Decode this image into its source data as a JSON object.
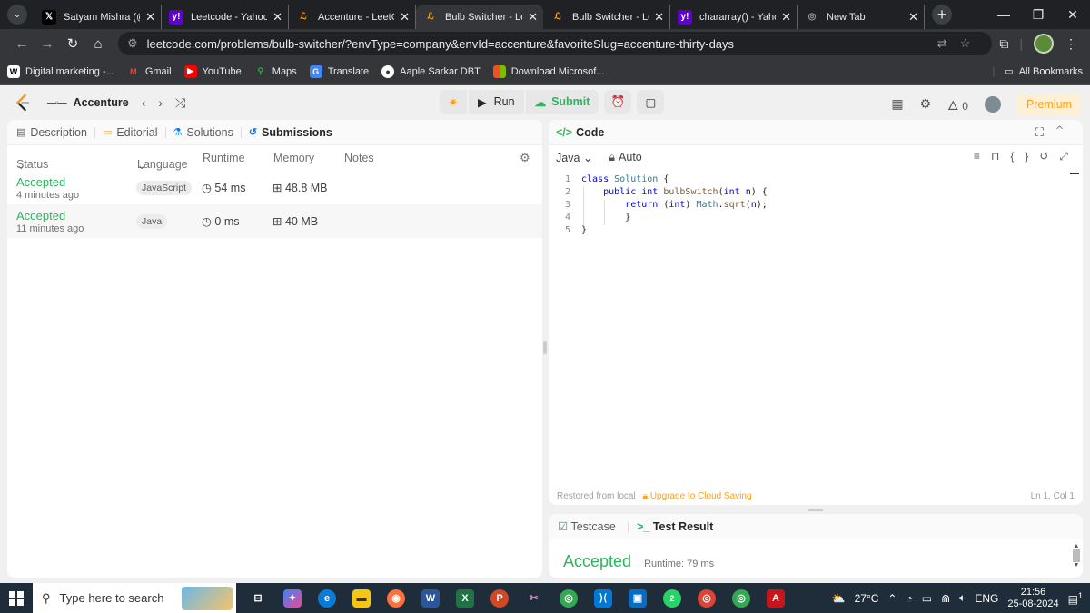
{
  "browser": {
    "tabs": [
      {
        "title": "Satyam Mishra (@its",
        "favicon": "x-icon",
        "active": false
      },
      {
        "title": "Leetcode - Yahoo Ind",
        "favicon": "yahoo-icon",
        "active": false
      },
      {
        "title": "Accenture - LeetCode",
        "favicon": "leetcode-icon",
        "active": false
      },
      {
        "title": "Bulb Switcher - LeetC",
        "favicon": "leetcode-icon",
        "active": true
      },
      {
        "title": "Bulb Switcher - LeetC",
        "favicon": "leetcode-icon",
        "active": false
      },
      {
        "title": "chararray() - Yahoo In",
        "favicon": "yahoo-icon",
        "active": false
      },
      {
        "title": "New Tab",
        "favicon": "globe-icon",
        "active": false
      }
    ],
    "url": "leetcode.com/problems/bulb-switcher/?envType=company&envId=accenture&favoriteSlug=accenture-thirty-days",
    "bookmarks": [
      {
        "label": "Digital marketing -...",
        "icon": "w-icon"
      },
      {
        "label": "Gmail",
        "icon": "gmail-icon"
      },
      {
        "label": "YouTube",
        "icon": "youtube-icon"
      },
      {
        "label": "Maps",
        "icon": "maps-icon"
      },
      {
        "label": "Translate",
        "icon": "translate-icon"
      },
      {
        "label": "Aaple Sarkar DBT",
        "icon": "circle-icon"
      },
      {
        "label": "Download Microsof...",
        "icon": "microsoft-icon"
      }
    ],
    "all_bookmarks": "All Bookmarks"
  },
  "lc_nav": {
    "problem_list": "Accenture",
    "run_label": "Run",
    "submit_label": "Submit",
    "streak_count": "0",
    "premium_label": "Premium"
  },
  "left_panel": {
    "tabs": [
      "Description",
      "Editorial",
      "Solutions",
      "Submissions"
    ],
    "columns": [
      "Status",
      "Language",
      "Runtime",
      "Memory",
      "Notes"
    ],
    "submissions": [
      {
        "status": "Accepted",
        "time": "4 minutes ago",
        "language": "JavaScript",
        "runtime": "54 ms",
        "memory": "48.8 MB"
      },
      {
        "status": "Accepted",
        "time": "11 minutes ago",
        "language": "Java",
        "runtime": "0 ms",
        "memory": "40 MB"
      }
    ]
  },
  "code_panel": {
    "title": "Code",
    "language": "Java",
    "mode": "Auto",
    "lines": [
      "1",
      "2",
      "3",
      "4",
      "5"
    ],
    "footer_saved": "Restored from local",
    "footer_upgrade": "Upgrade to Cloud Saving",
    "cursor_pos": "Ln 1, Col 1"
  },
  "result_panel": {
    "tab_testcase": "Testcase",
    "tab_result": "Test Result",
    "status": "Accepted",
    "runtime": "Runtime: 79 ms"
  },
  "taskbar": {
    "search_placeholder": "Type here to search",
    "temperature": "27°C",
    "lang": "ENG",
    "time": "21:56",
    "date": "25-08-2024",
    "notification_count": "1",
    "whatsapp_badge": "2"
  },
  "colors": {
    "accent_green": "#2db55d",
    "premium_orange": "#ffa116"
  }
}
